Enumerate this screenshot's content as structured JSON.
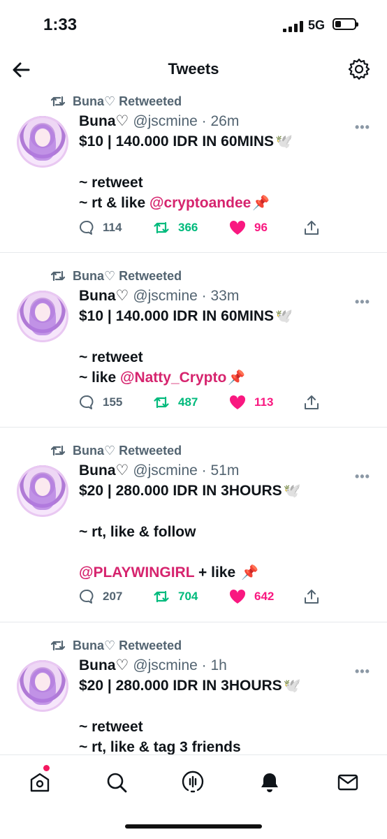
{
  "status_bar": {
    "time": "1:33",
    "network": "5G",
    "battery_level": 0.25
  },
  "header": {
    "title": "Tweets",
    "back_icon": "arrow-left-icon",
    "settings_icon": "gear-icon"
  },
  "colors": {
    "mention": "#d6246e",
    "retweet": "#00ba7c",
    "like": "#f91880",
    "muted": "#536471"
  },
  "tweets": [
    {
      "context": "Buna♡ Retweeted",
      "name": "Buna♡",
      "handle": "@jscmine · 26m",
      "line1": "$10 | 140.000 IDR IN 60MINS",
      "emoji1": "🕊️",
      "line2": "~ retweet",
      "line3_prefix": "~ rt & like ",
      "mention": "@cryptoandee",
      "emoji3": "📌",
      "replies": "114",
      "retweets": "366",
      "likes": "96"
    },
    {
      "context": "Buna♡ Retweeted",
      "name": "Buna♡",
      "handle": "@jscmine · 33m",
      "line1": "$10 | 140.000 IDR IN 60MINS",
      "emoji1": "🕊️",
      "line2": "~ retweet",
      "line3_prefix": "~ like ",
      "mention": "@Natty_Crypto",
      "emoji3": "📌",
      "replies": "155",
      "retweets": "487",
      "likes": "113"
    },
    {
      "context": "Buna♡ Retweeted",
      "name": "Buna♡",
      "handle": "@jscmine · 51m",
      "line1": "$20 | 280.000 IDR IN 3HOURS",
      "emoji1": "🕊️",
      "line2": "~ rt, like & follow",
      "mention": "@PLAYWINGIRL",
      "line4_suffix": " + like ",
      "emoji3": "📌",
      "replies": "207",
      "retweets": "704",
      "likes": "642"
    },
    {
      "context": "Buna♡ Retweeted",
      "name": "Buna♡",
      "handle": "@jscmine · 1h",
      "line1": "$20 | 280.000 IDR IN 3HOURS",
      "emoji1": "🕊️",
      "line2": "~ retweet",
      "line3": "~ rt, like & tag 3 friends"
    }
  ],
  "tabs": [
    {
      "icon": "home-icon",
      "has_notification_dot": true
    },
    {
      "icon": "search-icon"
    },
    {
      "icon": "spaces-icon"
    },
    {
      "icon": "bell-icon"
    },
    {
      "icon": "mail-icon"
    }
  ]
}
